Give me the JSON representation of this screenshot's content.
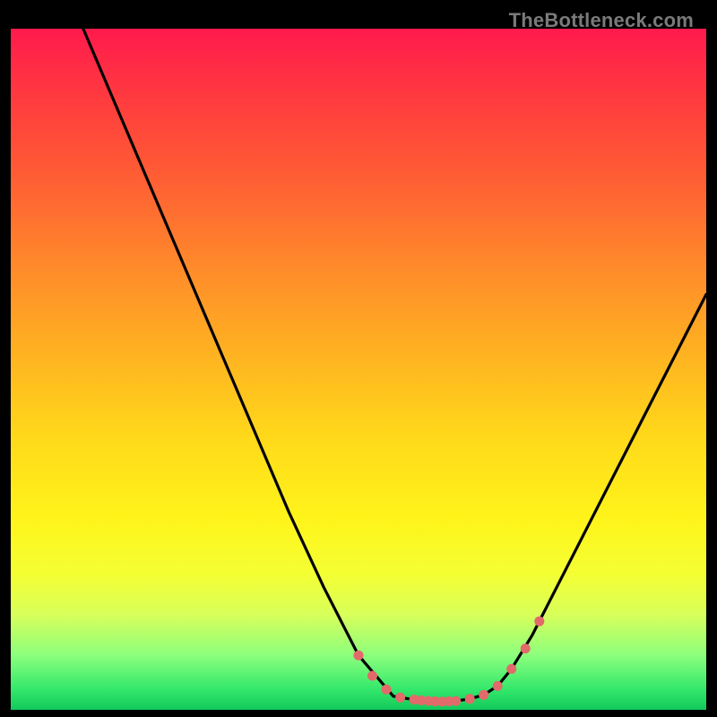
{
  "watermark": "TheBottleneck.com",
  "colors": {
    "background": "#000000",
    "curve": "#000000",
    "marker": "#e26a6a",
    "gradient_top": "#ff1a4d",
    "gradient_bottom": "#12c95a"
  },
  "chart_data": {
    "type": "line",
    "title": "",
    "xlabel": "",
    "ylabel": "",
    "xlim": [
      0,
      100
    ],
    "ylim": [
      0,
      100
    ],
    "grid": false,
    "legend": false,
    "series": [
      {
        "name": "bottleneck-curve",
        "x": [
          0,
          5,
          10,
          15,
          20,
          25,
          30,
          35,
          40,
          45,
          50,
          55,
          56,
          58,
          60,
          62,
          64,
          66,
          68,
          70,
          72,
          75,
          80,
          85,
          90,
          95,
          100
        ],
        "y": [
          125,
          113,
          101,
          89,
          77,
          65,
          53,
          41,
          29,
          18,
          8,
          2,
          1.8,
          1.5,
          1.3,
          1.2,
          1.3,
          1.6,
          2.2,
          3.5,
          6,
          11,
          21,
          31,
          41,
          51,
          61
        ]
      }
    ],
    "markers": {
      "name": "highlight-points",
      "x": [
        50,
        52,
        54,
        56,
        58,
        59,
        60,
        61,
        62,
        63,
        64,
        66,
        68,
        70,
        72,
        74,
        76
      ],
      "y": [
        8,
        5,
        3,
        1.8,
        1.5,
        1.4,
        1.3,
        1.25,
        1.2,
        1.25,
        1.3,
        1.6,
        2.2,
        3.5,
        6,
        9,
        13
      ]
    }
  }
}
